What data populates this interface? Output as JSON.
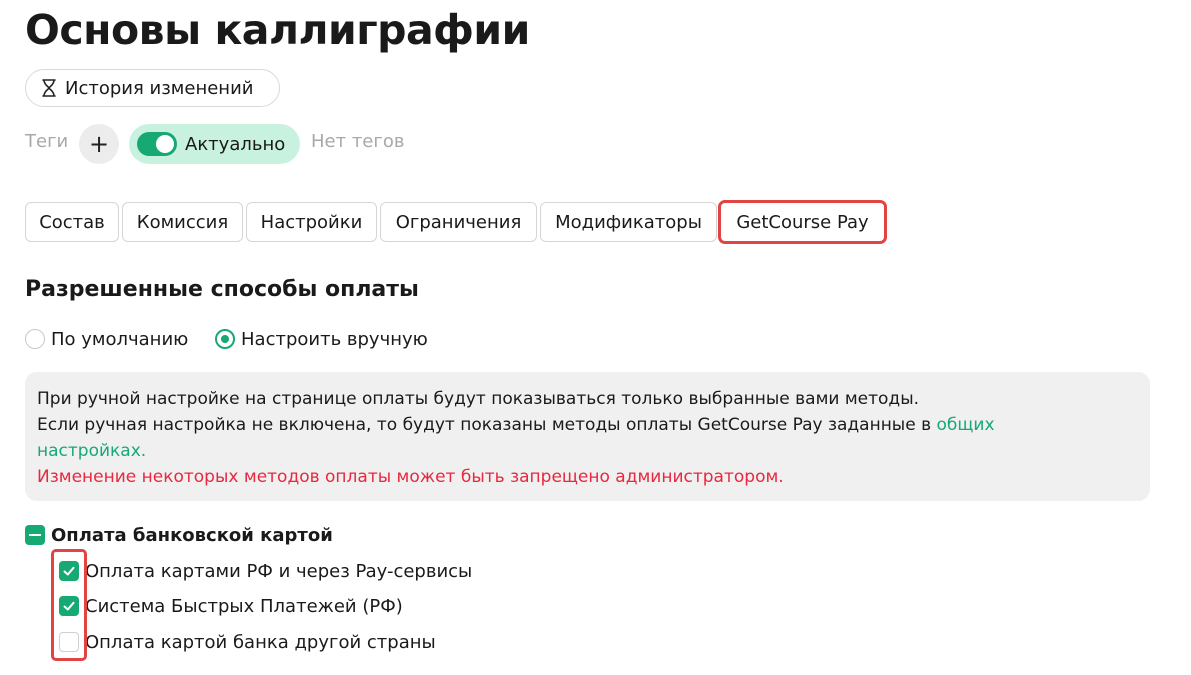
{
  "page": {
    "title": "Основы каллиграфии"
  },
  "history_button": {
    "icon": "hourglass-icon",
    "label": "История изменений"
  },
  "tags": {
    "label": "Теги",
    "add_label": "+",
    "status_label": "Актуально",
    "status_on": true,
    "empty_label": "Нет тегов"
  },
  "tabs": [
    {
      "label": "Состав",
      "active": false
    },
    {
      "label": "Комиссия",
      "active": false
    },
    {
      "label": "Настройки",
      "active": false
    },
    {
      "label": "Ограничения",
      "active": false
    },
    {
      "label": "Модификаторы",
      "active": false
    },
    {
      "label": "GetCourse Pay",
      "active": true
    }
  ],
  "payment_methods": {
    "title": "Разрешенные способы оплаты",
    "mode_options": [
      {
        "label": "По умолчанию",
        "selected": false
      },
      {
        "label": "Настроить вручную",
        "selected": true
      }
    ],
    "info": {
      "line1": "При ручной настройке на странице оплаты будут показываться только выбранные вами методы.",
      "line2_prefix": "Если ручная настройка не включена, то будут показаны методы оплаты GetCourse Pay заданные в ",
      "line2_link": "общих",
      "line3_link": "настройках.",
      "warning": "Изменение некоторых методов оплаты может быть запрещено администратором."
    },
    "group": {
      "label": "Оплата банковской картой",
      "state": "partial",
      "items": [
        {
          "label": "Оплата картами РФ и через Pay-сервисы",
          "checked": true
        },
        {
          "label": "Система Быстрых Платежей (РФ)",
          "checked": true
        },
        {
          "label": "Оплата картой банка другой страны",
          "checked": false
        }
      ]
    }
  },
  "colors": {
    "accent": "#16a974",
    "status_bg": "#c9f1df",
    "warning": "#e8283f",
    "highlight": "#e24343"
  }
}
